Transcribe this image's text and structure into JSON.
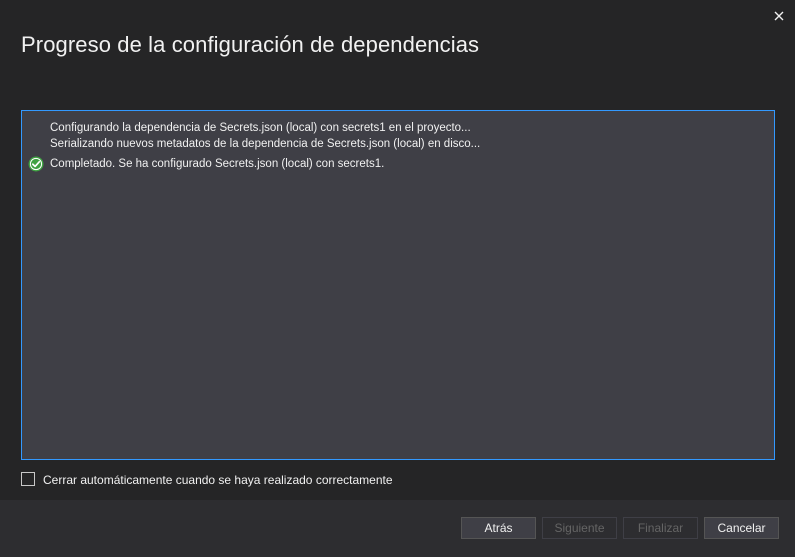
{
  "dialog": {
    "title": "Progreso de la configuración de dependencias",
    "close_icon": "close-icon"
  },
  "log": {
    "lines": [
      {
        "text": "Configurando la dependencia de Secrets.json (local) con secrets1 en el proyecto...",
        "icon": ""
      },
      {
        "text": "Serializando nuevos metadatos de la dependencia de Secrets.json (local) en disco...",
        "icon": ""
      },
      {
        "text": "Completado. Se ha configurado Secrets.json (local) con secrets1.",
        "icon": "success-check-icon"
      }
    ]
  },
  "auto_close": {
    "label": "Cerrar automáticamente cuando se haya realizado correctamente",
    "checked": false
  },
  "buttons": {
    "back": "Atrás",
    "next": "Siguiente",
    "finish": "Finalizar",
    "cancel": "Cancelar"
  },
  "colors": {
    "background": "#252526",
    "footer": "#2d2d30",
    "log_background": "#3f3f46",
    "focus_border": "#3399ff",
    "success": "#3fa142",
    "disabled_text": "#656565"
  }
}
